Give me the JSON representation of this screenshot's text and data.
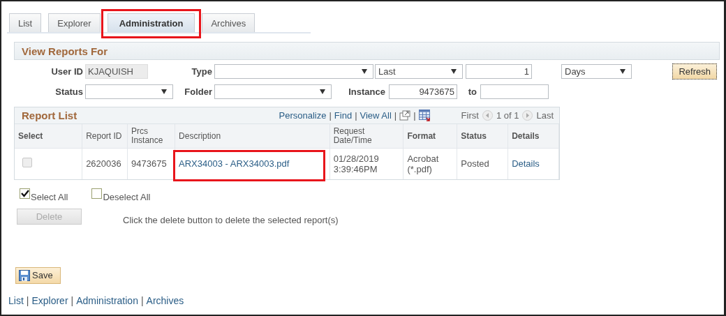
{
  "tabs": [
    {
      "label": "List",
      "selected": false,
      "highlighted": false
    },
    {
      "label": "Explorer",
      "selected": false,
      "highlighted": false
    },
    {
      "label": "Administration",
      "selected": true,
      "highlighted": true
    },
    {
      "label": "Archives",
      "selected": false,
      "highlighted": false
    }
  ],
  "view_reports": {
    "title": "View Reports For",
    "user_id": {
      "label": "User ID",
      "value": "KJAQUISH"
    },
    "type": {
      "label": "Type"
    },
    "range": {
      "value": "Last"
    },
    "count": {
      "value": "1"
    },
    "unit": {
      "value": "Days"
    },
    "refresh": "Refresh",
    "status": {
      "label": "Status"
    },
    "folder": {
      "label": "Folder"
    },
    "instance": {
      "label": "Instance",
      "value": "9473675"
    },
    "to": {
      "label": "to"
    }
  },
  "report_list": {
    "title": "Report List",
    "links": [
      "Personalize",
      "Find",
      "View All"
    ],
    "separator": "|",
    "first": "First",
    "page": "1 of 1",
    "last": "Last",
    "columns": [
      "Select",
      "Report ID",
      "Prcs Instance",
      "Description",
      "Request Date/Time",
      "Format",
      "Status",
      "Details"
    ],
    "rows": [
      {
        "checked": false,
        "disabled": true,
        "report_id": "2620036",
        "prcs_instance": "9473675",
        "description": "ARX34003 - ARX34003.pdf",
        "description_highlighted": true,
        "request_datetime": "01/28/2019 3:39:46PM",
        "format": "Acrobat (*.pdf)",
        "status": "Posted",
        "details": "Details"
      }
    ]
  },
  "select_all": {
    "label": "Select All",
    "checked": true
  },
  "deselect_all": {
    "label": "Deselect All",
    "checked": false
  },
  "delete": {
    "label": "Delete",
    "disabled": true
  },
  "hint": "Click the delete button to delete the selected report(s)",
  "save": "Save",
  "footer_links": [
    "List",
    "Explorer",
    "Administration",
    "Archives"
  ],
  "footer_separator": "|"
}
